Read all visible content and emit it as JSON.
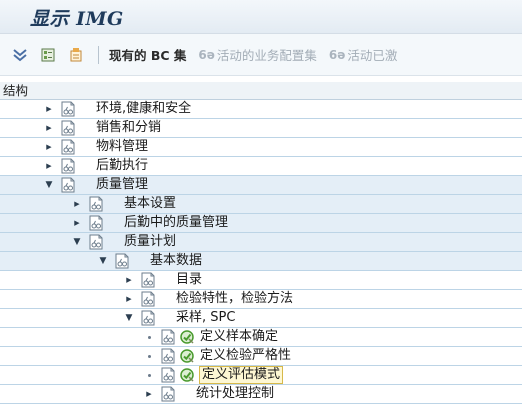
{
  "window": {
    "title": "显示 IMG"
  },
  "toolbar": {
    "icons": [
      "expand-all-icon",
      "bookmark-icon",
      "release-notes-icon"
    ],
    "existing_bc_sets": "现有的 BC 集",
    "active_business_config_sets": "活动的业务配置集",
    "activated_truncated": "活动已激"
  },
  "structure": {
    "header": "结构",
    "rows": [
      {
        "label": "环境,健康和安全",
        "level": 0,
        "state": "collapsed",
        "exec": false,
        "band": false
      },
      {
        "label": "销售和分销",
        "level": 0,
        "state": "collapsed",
        "exec": false,
        "band": false
      },
      {
        "label": "物料管理",
        "level": 0,
        "state": "collapsed",
        "exec": false,
        "band": false
      },
      {
        "label": "后勤执行",
        "level": 0,
        "state": "collapsed",
        "exec": false,
        "band": false
      },
      {
        "label": "质量管理",
        "level": 0,
        "state": "expanded",
        "exec": false,
        "band": true
      },
      {
        "label": "基本设置",
        "level": 1,
        "state": "collapsed",
        "exec": false,
        "band": true
      },
      {
        "label": "后勤中的质量管理",
        "level": 1,
        "state": "collapsed",
        "exec": false,
        "band": true
      },
      {
        "label": "质量计划",
        "level": 1,
        "state": "expanded",
        "exec": false,
        "band": true
      },
      {
        "label": "基本数据",
        "level": 2,
        "state": "expanded",
        "exec": false,
        "band": true
      },
      {
        "label": "目录",
        "level": 3,
        "state": "collapsed",
        "exec": false,
        "band": false
      },
      {
        "label": "检验特性，检验方法",
        "level": 3,
        "state": "collapsed",
        "exec": false,
        "band": false
      },
      {
        "label": "采样, SPC",
        "level": 3,
        "state": "expanded",
        "exec": false,
        "band": false
      },
      {
        "label": "定义样本确定",
        "level": 4,
        "state": "leaf",
        "exec": true,
        "band": false
      },
      {
        "label": "定义检验严格性",
        "level": 4,
        "state": "leaf",
        "exec": true,
        "band": false
      },
      {
        "label": "定义评估模式",
        "level": 4,
        "state": "leaf",
        "exec": true,
        "band": false,
        "selected": true
      },
      {
        "label": "统计处理控制",
        "level": 4,
        "state": "collapsed",
        "exec": false,
        "band": false
      }
    ]
  },
  "colors": {
    "title": "#1f3b5c",
    "row_band": "#e4eef7",
    "row_line": "#bcd4e6",
    "selection_bg": "#fdf7d3",
    "selection_border": "#d7b94a",
    "exec_green": "#4a9a2e"
  }
}
